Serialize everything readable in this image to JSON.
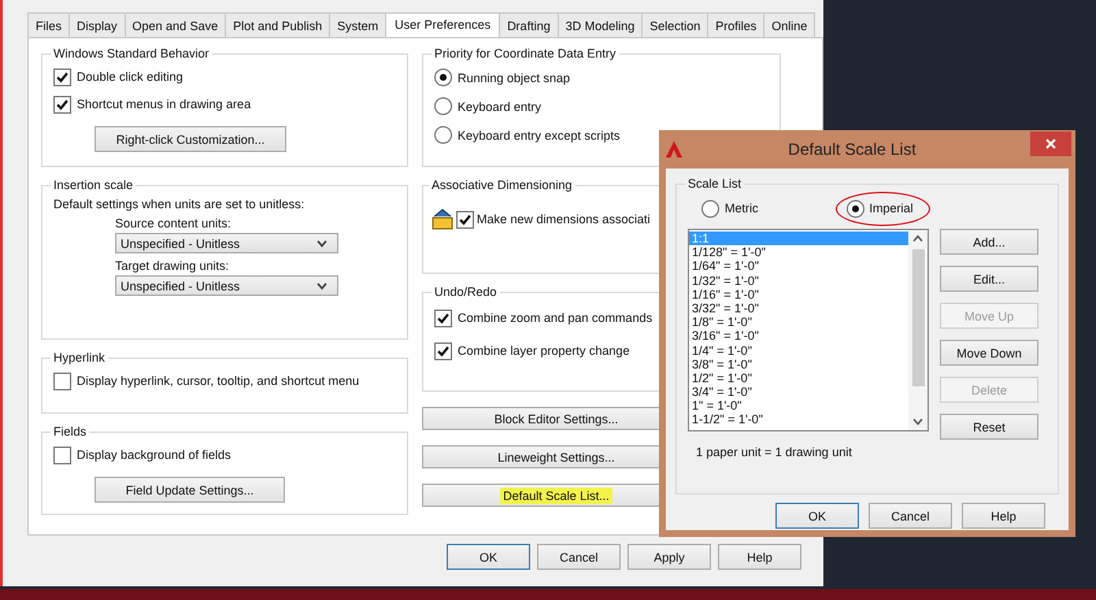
{
  "tabs": [
    {
      "label": "Files",
      "selected": false
    },
    {
      "label": "Display",
      "selected": false
    },
    {
      "label": "Open and Save",
      "selected": false
    },
    {
      "label": "Plot and Publish",
      "selected": false
    },
    {
      "label": "System",
      "selected": false
    },
    {
      "label": "User Preferences",
      "selected": true
    },
    {
      "label": "Drafting",
      "selected": false
    },
    {
      "label": "3D Modeling",
      "selected": false
    },
    {
      "label": "Selection",
      "selected": false
    },
    {
      "label": "Profiles",
      "selected": false
    },
    {
      "label": "Online",
      "selected": false
    }
  ],
  "windows_standard_behavior": {
    "title": "Windows Standard Behavior",
    "checkboxes": [
      {
        "label": "Double click editing",
        "checked": true
      },
      {
        "label": "Shortcut menus in drawing area",
        "checked": true
      }
    ],
    "button": "Right-click Customization..."
  },
  "insertion_scale": {
    "title": "Insertion scale",
    "description": "Default settings when units are set to unitless:",
    "fields": [
      {
        "label": "Source content units:",
        "value": "Unspecified - Unitless"
      },
      {
        "label": "Target drawing units:",
        "value": "Unspecified - Unitless"
      }
    ]
  },
  "hyperlink": {
    "title": "Hyperlink",
    "checkboxes": [
      {
        "label": "Display hyperlink, cursor, tooltip, and shortcut menu",
        "checked": false
      }
    ]
  },
  "fields": {
    "title": "Fields",
    "checkboxes": [
      {
        "label": "Display background of fields",
        "checked": false
      }
    ],
    "button": "Field Update Settings..."
  },
  "priority": {
    "title": "Priority for Coordinate Data Entry",
    "options": [
      {
        "label": "Running object snap",
        "selected": true
      },
      {
        "label": "Keyboard entry",
        "selected": false
      },
      {
        "label": "Keyboard entry except scripts",
        "selected": false
      }
    ]
  },
  "associative_dimensioning": {
    "title": "Associative Dimensioning",
    "checkboxes": [
      {
        "label": "Make new dimensions associati",
        "checked": true
      }
    ]
  },
  "undo_redo": {
    "title": "Undo/Redo",
    "checkboxes": [
      {
        "label": "Combine zoom and pan commands",
        "checked": true
      },
      {
        "label": "Combine layer property change",
        "checked": true
      }
    ]
  },
  "settings_buttons": [
    {
      "label": "Block Editor Settings...",
      "highlighted": false
    },
    {
      "label": "Lineweight Settings...",
      "highlighted": false
    },
    {
      "label": "Default Scale List...",
      "highlighted": true
    }
  ],
  "dialog_buttons": [
    "OK",
    "Cancel",
    "Apply",
    "Help"
  ],
  "scale_dialog": {
    "title": "Default Scale List",
    "group_title": "Scale List",
    "unit_options": [
      {
        "label": "Metric",
        "selected": false,
        "circled": false
      },
      {
        "label": "Imperial",
        "selected": true,
        "circled": true
      }
    ],
    "scales": [
      {
        "label": "1:1",
        "selected": true
      },
      {
        "label": "1/128\" = 1'-0\"",
        "selected": false
      },
      {
        "label": "1/64\" = 1'-0\"",
        "selected": false
      },
      {
        "label": "1/32\" = 1'-0\"",
        "selected": false
      },
      {
        "label": "1/16\" = 1'-0\"",
        "selected": false
      },
      {
        "label": "3/32\" = 1'-0\"",
        "selected": false
      },
      {
        "label": "1/8\" = 1'-0\"",
        "selected": false
      },
      {
        "label": "3/16\" = 1'-0\"",
        "selected": false
      },
      {
        "label": "1/4\" = 1'-0\"",
        "selected": false
      },
      {
        "label": "3/8\" = 1'-0\"",
        "selected": false
      },
      {
        "label": "1/2\" = 1'-0\"",
        "selected": false
      },
      {
        "label": "3/4\" = 1'-0\"",
        "selected": false
      },
      {
        "label": "1\" = 1'-0\"",
        "selected": false
      },
      {
        "label": "1-1/2\" = 1'-0\"",
        "selected": false
      }
    ],
    "side_buttons": [
      {
        "label": "Add...",
        "disabled": false
      },
      {
        "label": "Edit...",
        "disabled": false
      },
      {
        "label": "Move Up",
        "disabled": true
      },
      {
        "label": "Move Down",
        "disabled": false
      },
      {
        "label": "Delete",
        "disabled": true
      },
      {
        "label": "Reset",
        "disabled": false
      }
    ],
    "note": "1 paper unit = 1 drawing unit",
    "buttons": [
      "OK",
      "Cancel",
      "Help"
    ]
  }
}
